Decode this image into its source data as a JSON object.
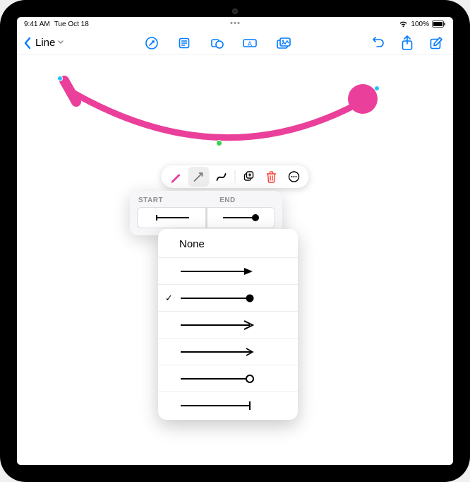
{
  "status": {
    "time": "9:41 AM",
    "date": "Tue Oct 18",
    "battery_percent": "100%"
  },
  "nav": {
    "title": "Line",
    "tools": {
      "markup": "markup-icon",
      "note": "note-icon",
      "shape": "shape-icon",
      "textbox": "textbox-icon",
      "media": "media-icon"
    },
    "actions": {
      "undo": "undo-icon",
      "share": "share-icon",
      "compose": "compose-icon"
    }
  },
  "edit_toolbar": {
    "tools": [
      "pen-icon",
      "arrow-icon",
      "curve-icon",
      "duplicate-icon",
      "delete-icon",
      "more-icon"
    ]
  },
  "endpoint_popover": {
    "tabs": {
      "start": "START",
      "end": "END"
    },
    "active_tab": "end",
    "start_style": "line-start-bar",
    "end_style": "line-end-ball"
  },
  "end_style_menu": {
    "options": [
      {
        "id": "none",
        "label": "None",
        "type": "none"
      },
      {
        "id": "arrow-filled",
        "type": "arrow-filled"
      },
      {
        "id": "ball",
        "type": "ball"
      },
      {
        "id": "arrow-open",
        "type": "arrow-open"
      },
      {
        "id": "arrow-thin",
        "type": "arrow-thin"
      },
      {
        "id": "circle-open",
        "type": "circle-open"
      },
      {
        "id": "bar",
        "type": "bar"
      }
    ],
    "selected": "ball"
  },
  "colors": {
    "accent": "#007aff",
    "stroke": "#ea3f9a",
    "delete": "#ff3b30"
  }
}
